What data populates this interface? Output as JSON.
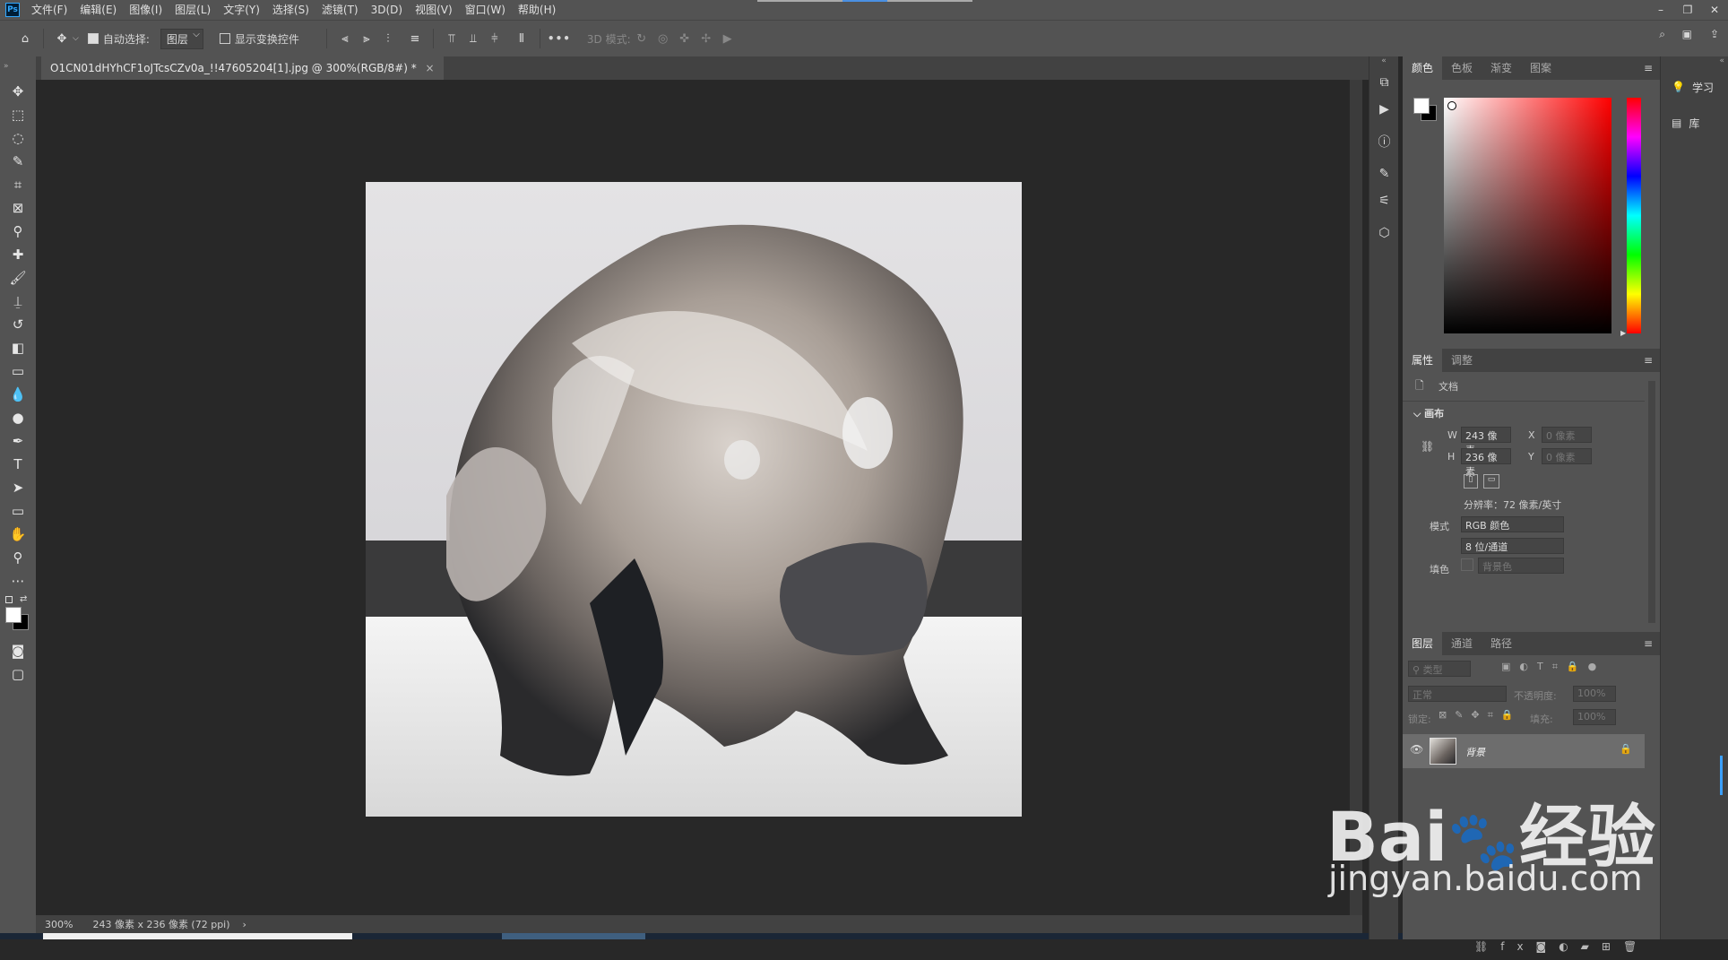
{
  "app": {
    "logo": "Ps"
  },
  "menu": [
    "文件(F)",
    "编辑(E)",
    "图像(I)",
    "图层(L)",
    "文字(Y)",
    "选择(S)",
    "滤镜(T)",
    "3D(D)",
    "视图(V)",
    "窗口(W)",
    "帮助(H)"
  ],
  "options": {
    "auto_select_label": "自动选择:",
    "auto_select_value": "图层",
    "show_transform_label": "显示变换控件",
    "mode_3d_label": "3D 模式:",
    "more": "•••"
  },
  "document": {
    "tab_title": "O1CN01dHYhCF1oJTcsCZv0a_!!47605204[1].jpg @ 300%(RGB/8#) *",
    "tab_close": "×"
  },
  "status": {
    "zoom": "300%",
    "info": "243 像素 x 236 像素 (72 ppi)",
    "arrow": "›"
  },
  "color_panel": {
    "tabs": [
      "颜色",
      "色板",
      "渐变",
      "图案"
    ]
  },
  "properties_panel": {
    "tabs": [
      "属性",
      "调整"
    ],
    "doc_label": "文档",
    "section": "画布",
    "w_label": "W",
    "w_value": "243 像素",
    "h_label": "H",
    "h_value": "236 像素",
    "x_label": "X",
    "x_value": "0 像素",
    "y_label": "Y",
    "y_value": "0 像素",
    "resolution": "分辨率：72 像素/英寸",
    "mode_label": "模式",
    "mode_value": "RGB 颜色",
    "depth_value": "8 位/通道",
    "fill_label": "填色",
    "fill_value": "背景色"
  },
  "layers_panel": {
    "tabs": [
      "图层",
      "通道",
      "路径"
    ],
    "filter_placeholder": "类型",
    "blend_value": "正常",
    "opacity_label": "不透明度:",
    "opacity_value": "100%",
    "lock_label": "锁定:",
    "fill_label": "填充:",
    "fill_value": "100%",
    "layer_name": "背景"
  },
  "far_strip": {
    "learn": "学习",
    "library": "库"
  },
  "watermark": {
    "brand": "Bai",
    "brand2": "经验",
    "url": "jingyan.baidu.com"
  }
}
